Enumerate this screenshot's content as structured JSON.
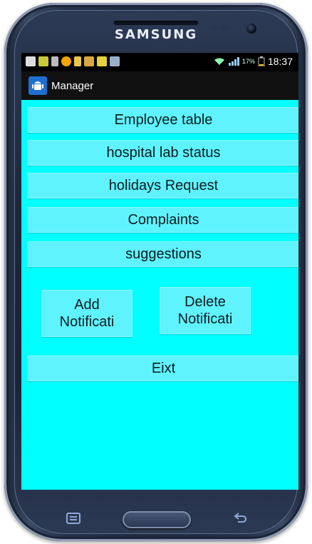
{
  "device": {
    "brand": "SAMSUNG"
  },
  "status_bar": {
    "battery": "17%",
    "time": "18:37"
  },
  "action_bar": {
    "title": "Manager",
    "icon": "android-icon"
  },
  "menu": {
    "items": [
      {
        "label": "Employee table"
      },
      {
        "label": "hospital lab status"
      },
      {
        "label": "holidays Request"
      },
      {
        "label": "Complaints"
      },
      {
        "label": "suggestions"
      }
    ]
  },
  "notifications": {
    "add": {
      "line1": "Add",
      "line2": "Notificati"
    },
    "delete": {
      "line1": "Delete",
      "line2": "Notificati"
    }
  },
  "exit": {
    "label": "Eixt"
  },
  "colors": {
    "screen_bg": "#00ffff",
    "button_bg": "#5ff3ff",
    "action_bar": "#111111"
  }
}
